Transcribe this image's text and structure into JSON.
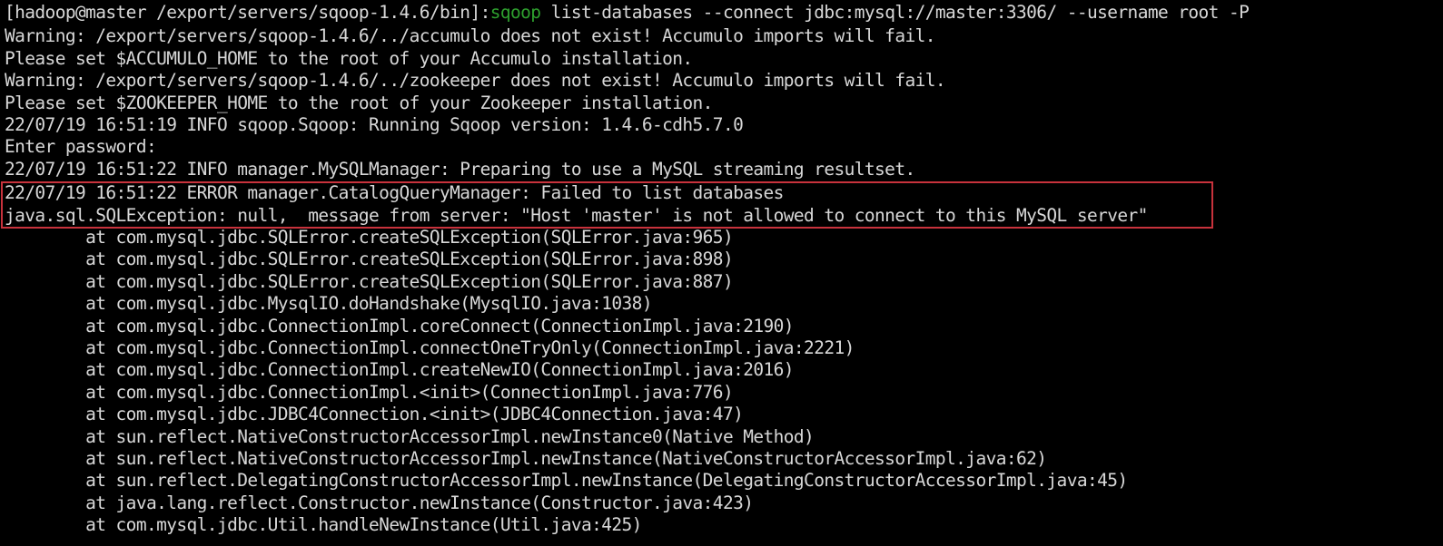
{
  "terminal": {
    "prompt": "[hadoop@master /export/servers/sqoop-1.4.6/bin]:",
    "command_name": "sqoop",
    "command_args": " list-databases --connect jdbc:mysql://master:3306/ --username root -P",
    "output_lines": [
      "Warning: /export/servers/sqoop-1.4.6/../accumulo does not exist! Accumulo imports will fail.",
      "Please set $ACCUMULO_HOME to the root of your Accumulo installation.",
      "Warning: /export/servers/sqoop-1.4.6/../zookeeper does not exist! Accumulo imports will fail.",
      "Please set $ZOOKEEPER_HOME to the root of your Zookeeper installation.",
      "22/07/19 16:51:19 INFO sqoop.Sqoop: Running Sqoop version: 1.4.6-cdh5.7.0",
      "Enter password:",
      "22/07/19 16:51:22 INFO manager.MySQLManager: Preparing to use a MySQL streaming resultset.",
      "22/07/19 16:51:22 ERROR manager.CatalogQueryManager: Failed to list databases",
      "java.sql.SQLException: null,  message from server: \"Host 'master' is not allowed to connect to this MySQL server\"",
      "        at com.mysql.jdbc.SQLError.createSQLException(SQLError.java:965)",
      "        at com.mysql.jdbc.SQLError.createSQLException(SQLError.java:898)",
      "        at com.mysql.jdbc.SQLError.createSQLException(SQLError.java:887)",
      "        at com.mysql.jdbc.MysqlIO.doHandshake(MysqlIO.java:1038)",
      "        at com.mysql.jdbc.ConnectionImpl.coreConnect(ConnectionImpl.java:2190)",
      "        at com.mysql.jdbc.ConnectionImpl.connectOneTryOnly(ConnectionImpl.java:2221)",
      "        at com.mysql.jdbc.ConnectionImpl.createNewIO(ConnectionImpl.java:2016)",
      "        at com.mysql.jdbc.ConnectionImpl.<init>(ConnectionImpl.java:776)",
      "        at com.mysql.jdbc.JDBC4Connection.<init>(JDBC4Connection.java:47)",
      "        at sun.reflect.NativeConstructorAccessorImpl.newInstance0(Native Method)",
      "        at sun.reflect.NativeConstructorAccessorImpl.newInstance(NativeConstructorAccessorImpl.java:62)",
      "        at sun.reflect.DelegatingConstructorAccessorImpl.newInstance(DelegatingConstructorAccessorImpl.java:45)",
      "        at java.lang.reflect.Constructor.newInstance(Constructor.java:423)",
      "        at com.mysql.jdbc.Util.handleNewInstance(Util.java:425)"
    ]
  },
  "colors": {
    "background": "#000000",
    "text": "#d8d8d8",
    "command_highlight": "#2e9f2e",
    "annotation_box": "#c8323c"
  }
}
